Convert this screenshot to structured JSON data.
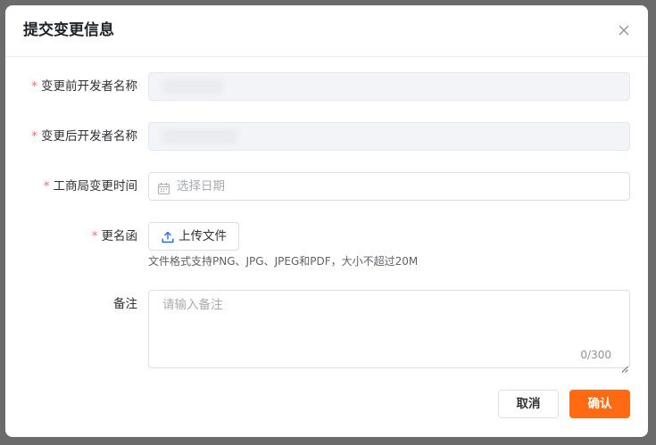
{
  "dialog": {
    "title": "提交变更信息",
    "close_icon": "close-icon"
  },
  "form": {
    "old_name": {
      "required_mark": "*",
      "label": "变更前开发者名称",
      "value": ""
    },
    "new_name": {
      "required_mark": "*",
      "label": "变更后开发者名称",
      "value": ""
    },
    "change_date": {
      "required_mark": "*",
      "label": "工商局变更时间",
      "placeholder": "选择日期",
      "icon": "calendar-icon"
    },
    "rename_letter": {
      "required_mark": "*",
      "label": "更名函",
      "upload_label": "上传文件",
      "upload_icon": "upload-icon",
      "hint": "文件格式支持PNG、JPG、JPEG和PDF，大小不超过20M"
    },
    "remark": {
      "label": "备注",
      "placeholder": "请输入备注",
      "counter": "0/300"
    }
  },
  "footer": {
    "cancel_label": "取消",
    "confirm_label": "确认"
  },
  "colors": {
    "accent": "#ff6a13",
    "required": "#f56c6c",
    "border": "#dcdfe6",
    "disabled_bg": "#f2f4f7"
  }
}
